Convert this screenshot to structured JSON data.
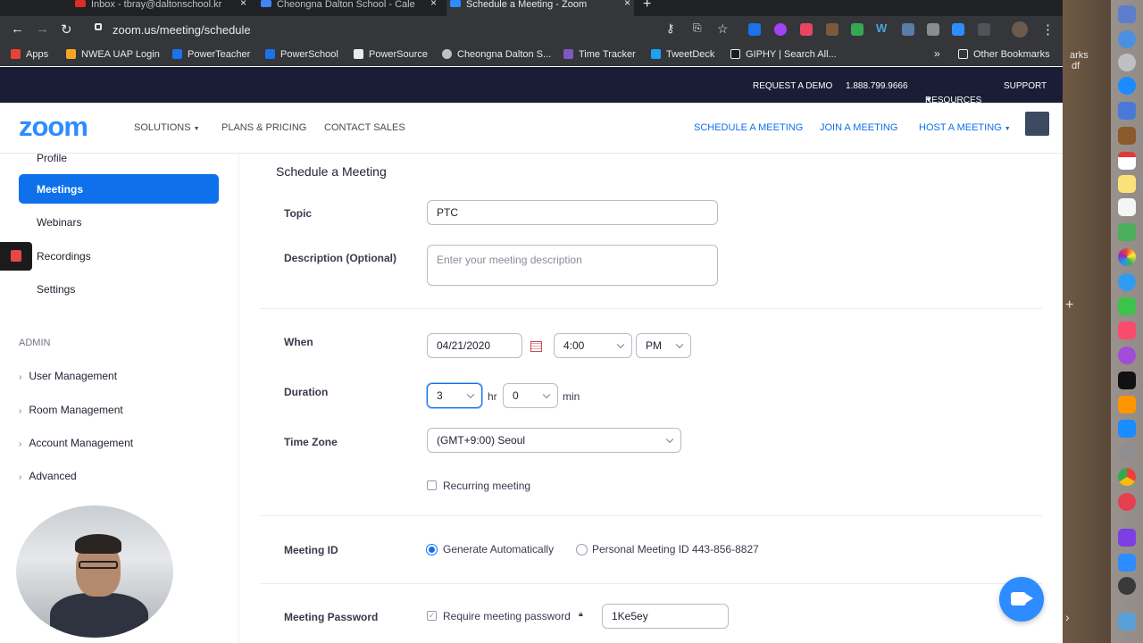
{
  "browser": {
    "tabs": [
      {
        "title": "Inbox - tbray@daltonschool.kr",
        "color": "#d93025",
        "active": false
      },
      {
        "title": "Cheongna Dalton School - Cale",
        "color": "#4285f4",
        "active": false
      },
      {
        "title": "Schedule a Meeting - Zoom",
        "color": "#2d8cff",
        "active": true
      }
    ],
    "url": "zoom.us/meeting/schedule",
    "bookmarks": [
      "Apps",
      "NWEA UAP Login",
      "PowerTeacher",
      "PowerSchool",
      "PowerSource",
      "Cheongna Dalton S...",
      "Time Tracker",
      "TweetDeck",
      "GIPHY | Search All...",
      "Other Bookmarks"
    ],
    "overflow": "»"
  },
  "topbar": {
    "request_demo": "REQUEST A DEMO",
    "phone": "1.888.799.9666",
    "resources": "RESOURCES",
    "support": "SUPPORT"
  },
  "nav": {
    "logo": "zoom",
    "solutions": "SOLUTIONS",
    "plans": "PLANS & PRICING",
    "contact": "CONTACT SALES",
    "schedule": "SCHEDULE A MEETING",
    "join": "JOIN A MEETING",
    "host": "HOST A MEETING"
  },
  "sidebar": {
    "items": [
      {
        "label": "Profile",
        "active": false
      },
      {
        "label": "Meetings",
        "active": true
      },
      {
        "label": "Webinars",
        "active": false
      },
      {
        "label": "Recordings",
        "active": false
      },
      {
        "label": "Settings",
        "active": false
      }
    ],
    "admin_heading": "ADMIN",
    "admin_items": [
      "User Management",
      "Room Management",
      "Account Management",
      "Advanced"
    ]
  },
  "form": {
    "title": "Schedule a Meeting",
    "topic_label": "Topic",
    "topic_value": "PTC",
    "description_label": "Description (Optional)",
    "description_placeholder": "Enter your meeting description",
    "when_label": "When",
    "date": "04/21/2020",
    "time": "4:00",
    "ampm": "PM",
    "duration_label": "Duration",
    "duration_hr": "3",
    "hr_unit": "hr",
    "duration_min": "0",
    "min_unit": "min",
    "timezone_label": "Time Zone",
    "timezone": "(GMT+9:00) Seoul",
    "recurring_label": "Recurring meeting",
    "meeting_id_label": "Meeting ID",
    "generate_auto": "Generate Automatically",
    "personal_id": "Personal Meeting ID 443-856-8827",
    "password_label": "Meeting Password",
    "require_password": "Require meeting password",
    "password_value": "1Ke5ey"
  },
  "desktop": {
    "edge_text_1": "arks",
    "edge_text_2": "df"
  }
}
